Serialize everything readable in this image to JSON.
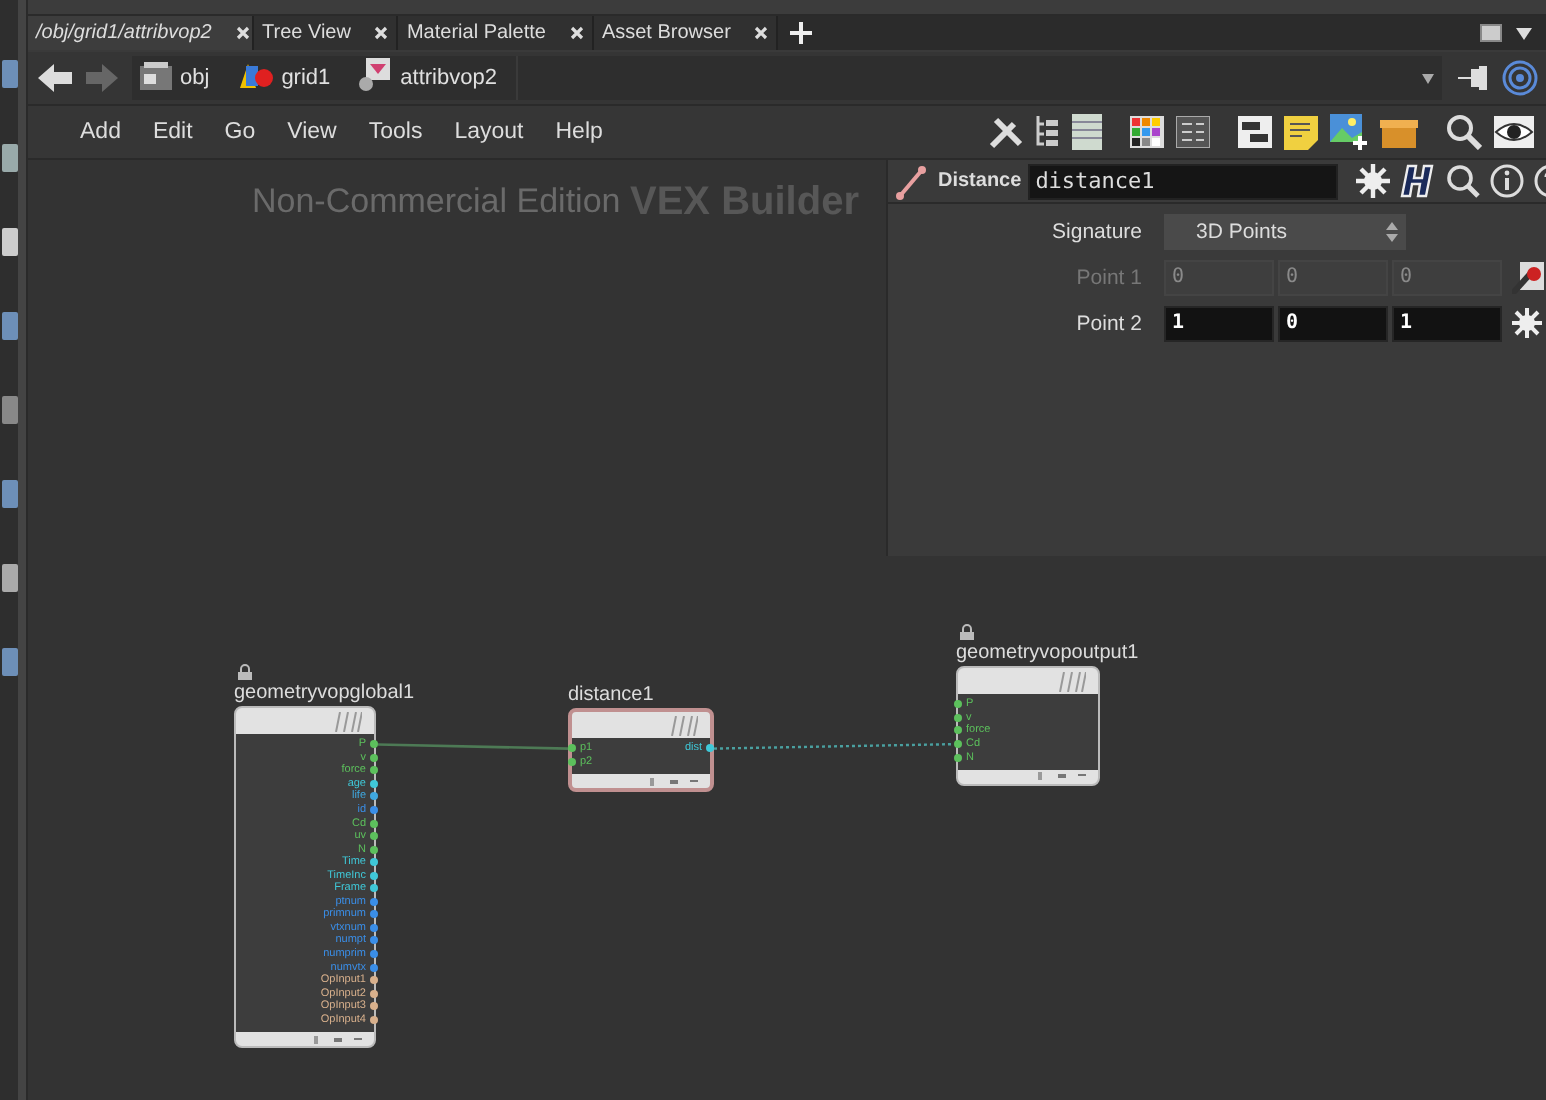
{
  "tabs": [
    {
      "label": "/obj/grid1/attribvop2",
      "selected": true
    },
    {
      "label": "Tree View",
      "selected": false
    },
    {
      "label": "Material Palette",
      "selected": false
    },
    {
      "label": "Asset Browser",
      "selected": false
    }
  ],
  "path": [
    {
      "label": "obj",
      "kind": "object"
    },
    {
      "label": "grid1",
      "kind": "geometry"
    },
    {
      "label": "attribvop2",
      "kind": "vop"
    }
  ],
  "menu": [
    "Add",
    "Edit",
    "Go",
    "View",
    "Tools",
    "Layout",
    "Help"
  ],
  "canvas": {
    "edition": "Non-Commercial Edition",
    "context": "VEX Builder"
  },
  "parameters": {
    "type_label": "Distance",
    "node_name": "distance1",
    "rows": [
      {
        "kind": "menu",
        "label": "Signature",
        "value": "3D Points"
      },
      {
        "kind": "vector",
        "label": "Point 1",
        "disabled": true,
        "values": [
          "0",
          "0",
          "0"
        ]
      },
      {
        "kind": "vector",
        "label": "Point 2",
        "disabled": false,
        "values": [
          "1",
          "0",
          "1"
        ]
      }
    ]
  },
  "nodes": [
    {
      "name": "geometryvopglobal1",
      "locked": true,
      "selected": false,
      "outputs": [
        {
          "label": "P",
          "color": "#5cc05c"
        },
        {
          "label": "v",
          "color": "#5cc05c"
        },
        {
          "label": "force",
          "color": "#5cc05c"
        },
        {
          "label": "age",
          "color": "#3fc8d8"
        },
        {
          "label": "life",
          "color": "#3fa8e0"
        },
        {
          "label": "id",
          "color": "#3a8ee8"
        },
        {
          "label": "Cd",
          "color": "#5cc05c"
        },
        {
          "label": "uv",
          "color": "#5cc05c"
        },
        {
          "label": "N",
          "color": "#5cc05c"
        },
        {
          "label": "Time",
          "color": "#3fc8d8"
        },
        {
          "label": "TimeInc",
          "color": "#3fc8d8"
        },
        {
          "label": "Frame",
          "color": "#3fc8d8"
        },
        {
          "label": "ptnum",
          "color": "#3a8ee8"
        },
        {
          "label": "primnum",
          "color": "#3a8ee8"
        },
        {
          "label": "vtxnum",
          "color": "#3a8ee8"
        },
        {
          "label": "numpt",
          "color": "#3a8ee8"
        },
        {
          "label": "numprim",
          "color": "#3a8ee8"
        },
        {
          "label": "numvtx",
          "color": "#3a8ee8"
        },
        {
          "label": "OpInput1",
          "color": "#d8b08c"
        },
        {
          "label": "OpInput2",
          "color": "#d8b08c"
        },
        {
          "label": "OpInput3",
          "color": "#d8b08c"
        },
        {
          "label": "OpInput4",
          "color": "#d8b08c"
        }
      ]
    },
    {
      "name": "distance1",
      "locked": false,
      "selected": true,
      "inputs": [
        {
          "label": "p1",
          "color": "#5cc05c"
        },
        {
          "label": "p2",
          "color": "#5cc05c"
        }
      ],
      "outputs": [
        {
          "label": "dist",
          "color": "#3fc8d8"
        }
      ]
    },
    {
      "name": "geometryvopoutput1",
      "locked": true,
      "selected": false,
      "inputs": [
        {
          "label": "P",
          "color": "#5cc05c"
        },
        {
          "label": "v",
          "color": "#5cc05c"
        },
        {
          "label": "force",
          "color": "#5cc05c"
        },
        {
          "label": "Cd",
          "color": "#5cc05c"
        },
        {
          "label": "N",
          "color": "#5cc05c"
        }
      ]
    }
  ]
}
